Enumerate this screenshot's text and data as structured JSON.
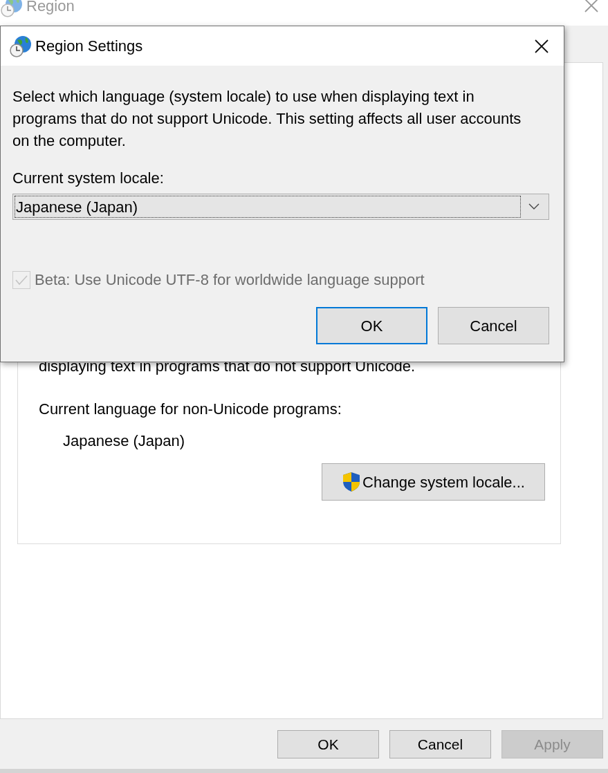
{
  "window": {
    "title": "Region"
  },
  "region_panel": {
    "partial_text": "displaying text in programs that do not support Unicode.",
    "current_label": "Current language for non-Unicode programs:",
    "current_value": "Japanese (Japan)",
    "change_button": "Change system locale..."
  },
  "footer_buttons": [
    {
      "label": "OK",
      "disabled": false
    },
    {
      "label": "Cancel",
      "disabled": false
    },
    {
      "label": "Apply",
      "disabled": true
    }
  ],
  "dialog": {
    "title": "Region Settings",
    "description": "Select which language (system locale) to use when displaying text in programs that do not support Unicode. This setting affects all user accounts on the computer.",
    "locale_label": "Current system locale:",
    "locale_value": "Japanese (Japan)",
    "beta_checkbox": {
      "label": "Beta: Use Unicode UTF-8 for worldwide language support",
      "checked": true,
      "disabled": true
    },
    "buttons": [
      {
        "label": "OK",
        "default": true
      },
      {
        "label": "Cancel",
        "default": false
      }
    ]
  }
}
